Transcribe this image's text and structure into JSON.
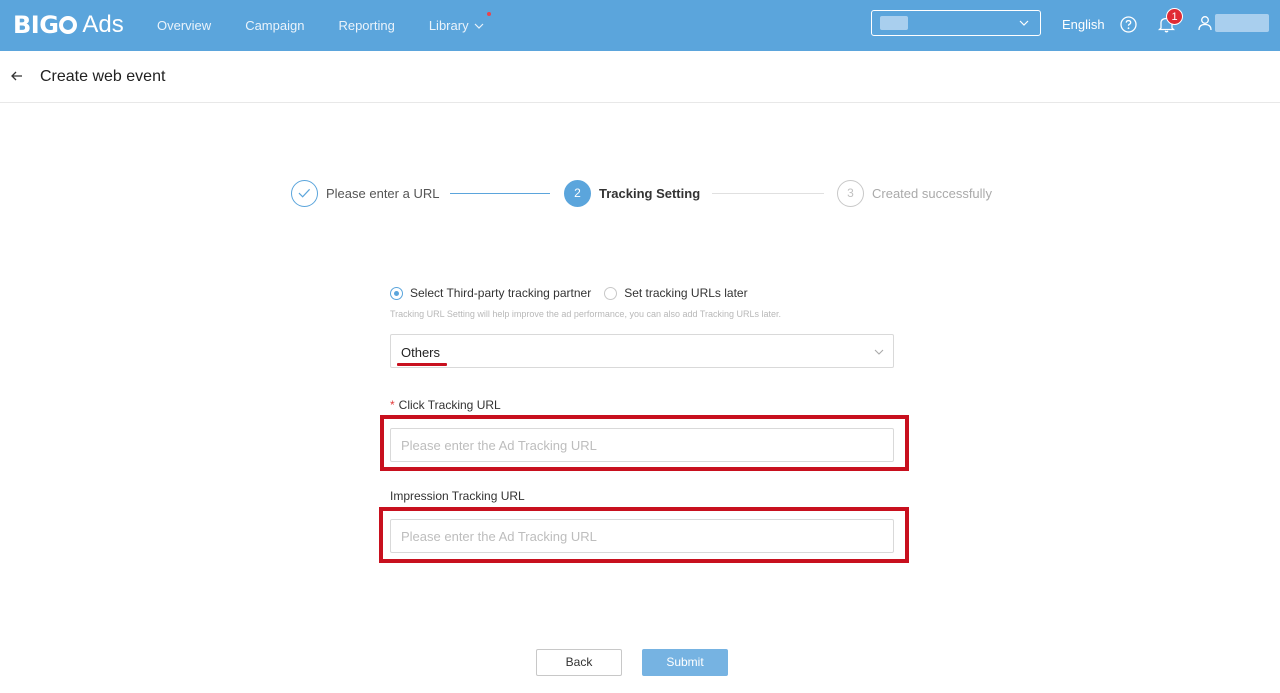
{
  "brand": {
    "logo_text": "BIGO Ads"
  },
  "nav": {
    "items": [
      {
        "label": "Overview"
      },
      {
        "label": "Campaign"
      },
      {
        "label": "Reporting"
      },
      {
        "label": "Library"
      }
    ]
  },
  "topbar": {
    "language": "English",
    "notification_count": "1"
  },
  "header": {
    "title": "Create web event"
  },
  "steps": [
    {
      "number": "✓",
      "label": "Please enter a URL",
      "state": "done"
    },
    {
      "number": "2",
      "label": "Tracking Setting",
      "state": "active"
    },
    {
      "number": "3",
      "label": "Created successfully",
      "state": "pending"
    }
  ],
  "form": {
    "radio_options": [
      {
        "label": "Select Third-party tracking partner",
        "checked": true
      },
      {
        "label": "Set tracking URLs later",
        "checked": false
      }
    ],
    "hint": "Tracking URL Setting will help improve the ad performance, you can also add Tracking URLs later.",
    "partner_select": {
      "value": "Others"
    },
    "click_url": {
      "label": "Click Tracking URL",
      "required_mark": "*",
      "placeholder": "Please enter the Ad Tracking URL",
      "value": ""
    },
    "impression_url": {
      "label": "Impression Tracking URL",
      "placeholder": "Please enter the Ad Tracking URL",
      "value": ""
    }
  },
  "actions": {
    "back_label": "Back",
    "submit_label": "Submit"
  },
  "colors": {
    "brand_blue": "#5ba5dc",
    "annotation_red": "#c8101e",
    "submit_blue": "#76b3e2"
  }
}
